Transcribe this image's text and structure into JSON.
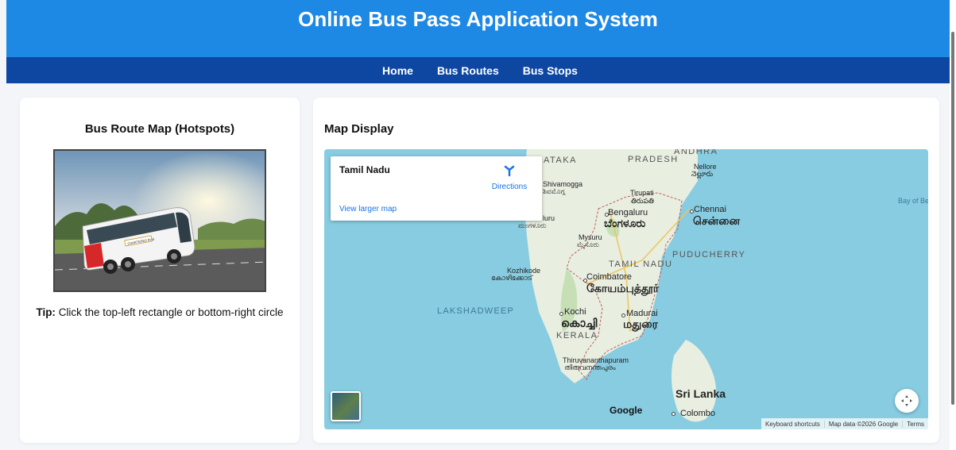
{
  "header": {
    "title": "Online Bus Pass Application System"
  },
  "nav": {
    "items": [
      {
        "label": "Home"
      },
      {
        "label": "Bus Routes"
      },
      {
        "label": "Bus Stops"
      }
    ]
  },
  "left_panel": {
    "title": "Bus Route Map (Hotspots)",
    "bus_brand_text": "CHARTERED BUS",
    "tip_label": "Tip:",
    "tip_text": " Click the top-left rectangle or bottom-right circle"
  },
  "right_panel": {
    "title": "Map Display",
    "place_card": {
      "name": "Tamil Nadu",
      "directions_label": "Directions",
      "larger_map_label": "View larger map"
    },
    "map_labels": {
      "andhra": "ANDHRA",
      "pradesh": "PRADESH",
      "ataka": "ATAKA",
      "nellore": "Nellore",
      "nellore_te": "నెల్లూరు",
      "shivamogga": "Shivamogga",
      "shivamogga_kn": "ಶಿವಮೊಗ್ಗ",
      "tirupati": "Tirupati",
      "tirupati_te": "తిరుపతి",
      "bay_of_bengal": "Bay of Be",
      "chennai": "Chennai",
      "chennai_ta": "சென்னை",
      "bengaluru": "Bengaluru",
      "bengaluru_kn": "ಬೆಂಗಳೂರು",
      "mangaluru": "luru",
      "mangaluru_kn": "ಮಂಗಳೂರು",
      "mysuru": "Mysuru",
      "mysuru_kn": "ಮೈಸೂರು",
      "puducherry": "PUDUCHERRY",
      "tamil_nadu": "TAMIL NADU",
      "kozhikode": "Kozhikode",
      "kozhikode_ml": "കോഴിക്കോട്",
      "coimbatore": "Coimbatore",
      "coimbatore_ta": "கோயம்புத்தூர்",
      "lakshadweep": "LAKSHADWEEP",
      "kochi": "Kochi",
      "kochi_ml": "കൊച്ചി",
      "madurai": "Madurai",
      "madurai_ta": "மதுரை",
      "kerala": "KERALA",
      "thiruvananthapuram": "Thiruvananthapuram",
      "thiruvananthapuram_ml": "തിരുവനന്തപുരം",
      "sri_lanka": "Sri Lanka",
      "colombo": "Colombo"
    },
    "google_logo": "Google",
    "footer": {
      "shortcuts": "Keyboard shortcuts",
      "map_data": "Map data ©2026 Google",
      "terms": "Terms"
    },
    "icons": {
      "directions": "directions-icon",
      "recenter": "recenter-icon",
      "satellite": "satellite-thumbnail"
    }
  },
  "colors": {
    "header": "#1e88e5",
    "nav": "#0d47a1",
    "sea": "#aadaff",
    "land": "#e8eee0"
  }
}
